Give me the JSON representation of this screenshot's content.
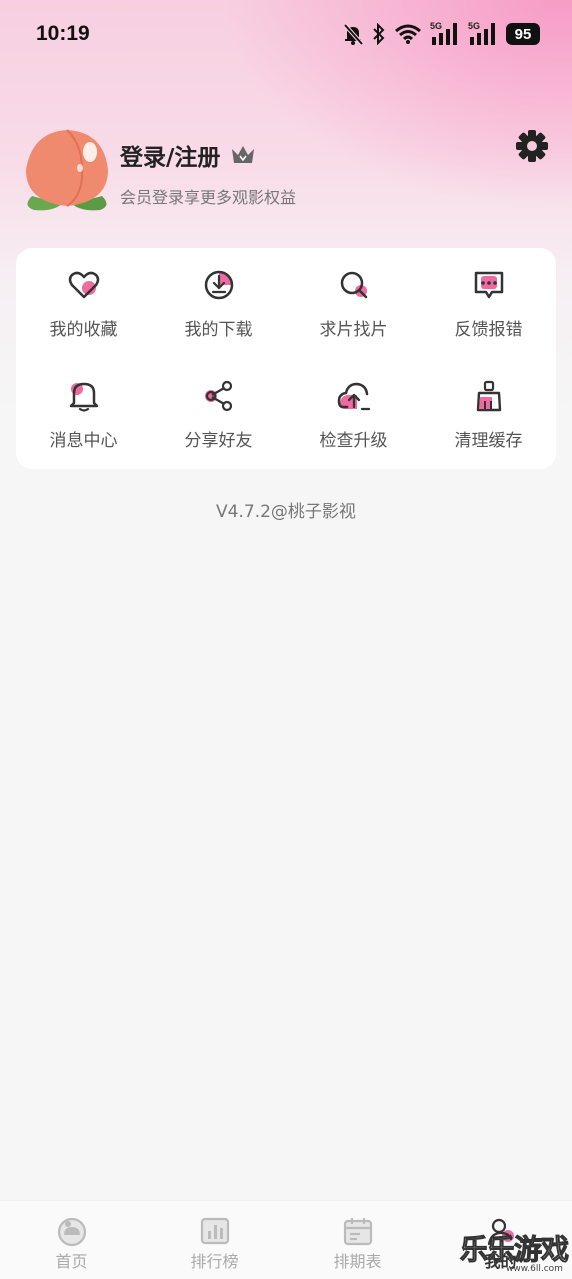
{
  "status_bar": {
    "time": "10:19",
    "network_1": "5G",
    "network_2": "5G",
    "battery": "95"
  },
  "profile": {
    "title": "登录/注册",
    "subtitle": "会员登录享更多观影权益",
    "avatar_icon": "peach-avatar-icon",
    "badge_icon": "crown-icon",
    "settings_icon": "gear-icon"
  },
  "menu": {
    "items": [
      {
        "label": "我的收藏",
        "icon": "heart-icon"
      },
      {
        "label": "我的下载",
        "icon": "download-icon"
      },
      {
        "label": "求片找片",
        "icon": "search-icon"
      },
      {
        "label": "反馈报错",
        "icon": "feedback-icon"
      },
      {
        "label": "消息中心",
        "icon": "bell-icon"
      },
      {
        "label": "分享好友",
        "icon": "share-icon"
      },
      {
        "label": "检查升级",
        "icon": "upgrade-icon"
      },
      {
        "label": "清理缓存",
        "icon": "broom-icon"
      }
    ]
  },
  "version": "V4.7.2@桃子影视",
  "tabs": [
    {
      "label": "首页",
      "icon": "home-icon",
      "active": false
    },
    {
      "label": "排行榜",
      "icon": "ranking-icon",
      "active": false
    },
    {
      "label": "排期表",
      "icon": "calendar-icon",
      "active": false
    },
    {
      "label": "我的",
      "icon": "profile-icon",
      "active": true
    }
  ],
  "watermark": {
    "text": "乐乐游戏",
    "url": "www.6ll.com"
  },
  "colors": {
    "accent_pink": "#ee6aa0",
    "peach": "#f08a6e",
    "text_dark": "#222222",
    "text_gray": "#777777"
  }
}
